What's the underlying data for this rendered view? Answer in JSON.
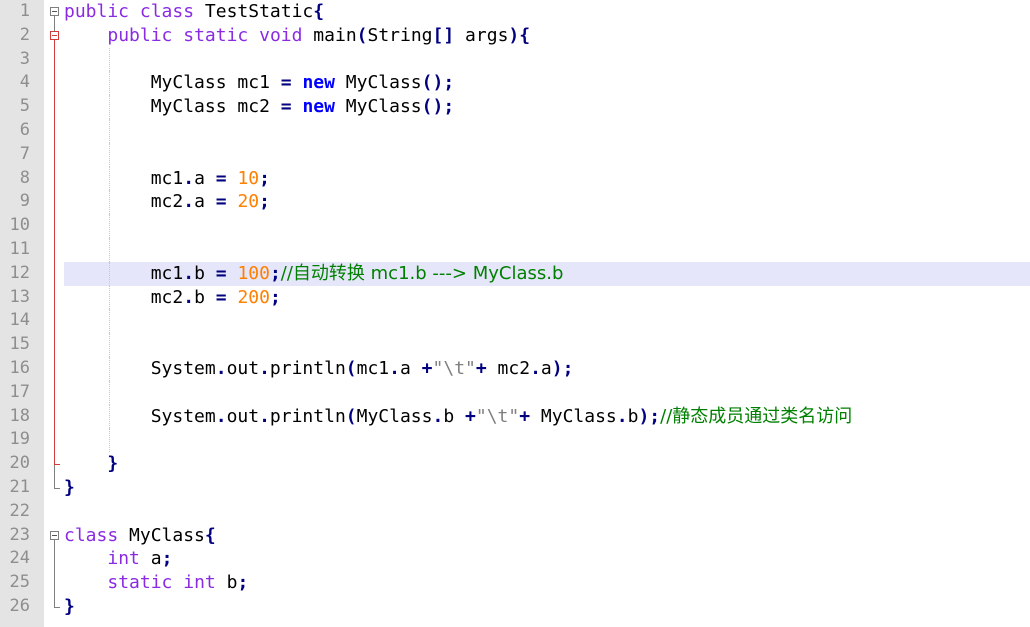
{
  "editor": {
    "language": "Java",
    "current_line": 12,
    "colors": {
      "keyword": "#8a2be2",
      "new_keyword": "#0000ff",
      "operator": "#000080",
      "number": "#ff8000",
      "string": "#808080",
      "comment": "#008000",
      "gutter_bg": "#e4e4e4",
      "current_line_bg": "#e6e6fa",
      "fold_marker": "#d23b3b"
    },
    "lines": [
      {
        "n": "1",
        "tokens": [
          {
            "t": "public",
            "c": "kw"
          },
          {
            "t": " ",
            "c": "pl"
          },
          {
            "t": "class",
            "c": "kw"
          },
          {
            "t": " TestStatic",
            "c": "pl"
          },
          {
            "t": "{",
            "c": "op"
          }
        ]
      },
      {
        "n": "2",
        "tokens": [
          {
            "t": "    ",
            "c": "pl"
          },
          {
            "t": "public",
            "c": "kw"
          },
          {
            "t": " ",
            "c": "pl"
          },
          {
            "t": "static",
            "c": "kw"
          },
          {
            "t": " ",
            "c": "pl"
          },
          {
            "t": "void",
            "c": "kw"
          },
          {
            "t": " main",
            "c": "pl"
          },
          {
            "t": "(",
            "c": "op"
          },
          {
            "t": "String",
            "c": "pl"
          },
          {
            "t": "[]",
            "c": "op"
          },
          {
            "t": " args",
            "c": "pl"
          },
          {
            "t": "){",
            "c": "op"
          }
        ]
      },
      {
        "n": "3",
        "tokens": []
      },
      {
        "n": "4",
        "tokens": [
          {
            "t": "        MyClass mc1 ",
            "c": "pl"
          },
          {
            "t": "=",
            "c": "op"
          },
          {
            "t": " ",
            "c": "pl"
          },
          {
            "t": "new",
            "c": "kwb"
          },
          {
            "t": " MyClass",
            "c": "pl"
          },
          {
            "t": "();",
            "c": "op"
          }
        ]
      },
      {
        "n": "5",
        "tokens": [
          {
            "t": "        MyClass mc2 ",
            "c": "pl"
          },
          {
            "t": "=",
            "c": "op"
          },
          {
            "t": " ",
            "c": "pl"
          },
          {
            "t": "new",
            "c": "kwb"
          },
          {
            "t": " MyClass",
            "c": "pl"
          },
          {
            "t": "();",
            "c": "op"
          }
        ]
      },
      {
        "n": "6",
        "tokens": []
      },
      {
        "n": "7",
        "tokens": []
      },
      {
        "n": "8",
        "tokens": [
          {
            "t": "        mc1",
            "c": "pl"
          },
          {
            "t": ".",
            "c": "op"
          },
          {
            "t": "a ",
            "c": "pl"
          },
          {
            "t": "=",
            "c": "op"
          },
          {
            "t": " ",
            "c": "pl"
          },
          {
            "t": "10",
            "c": "num"
          },
          {
            "t": ";",
            "c": "op"
          }
        ]
      },
      {
        "n": "9",
        "tokens": [
          {
            "t": "        mc2",
            "c": "pl"
          },
          {
            "t": ".",
            "c": "op"
          },
          {
            "t": "a ",
            "c": "pl"
          },
          {
            "t": "=",
            "c": "op"
          },
          {
            "t": " ",
            "c": "pl"
          },
          {
            "t": "20",
            "c": "num"
          },
          {
            "t": ";",
            "c": "op"
          }
        ]
      },
      {
        "n": "10",
        "tokens": []
      },
      {
        "n": "11",
        "tokens": []
      },
      {
        "n": "12",
        "tokens": [
          {
            "t": "        mc1",
            "c": "pl"
          },
          {
            "t": ".",
            "c": "op"
          },
          {
            "t": "b ",
            "c": "pl"
          },
          {
            "t": "=",
            "c": "op"
          },
          {
            "t": " ",
            "c": "pl"
          },
          {
            "t": "100",
            "c": "num"
          },
          {
            "t": ";",
            "c": "op"
          },
          {
            "t": "//自动转换 mc1.b ---> MyClass.b",
            "c": "cm"
          }
        ]
      },
      {
        "n": "13",
        "tokens": [
          {
            "t": "        mc2",
            "c": "pl"
          },
          {
            "t": ".",
            "c": "op"
          },
          {
            "t": "b ",
            "c": "pl"
          },
          {
            "t": "=",
            "c": "op"
          },
          {
            "t": " ",
            "c": "pl"
          },
          {
            "t": "200",
            "c": "num"
          },
          {
            "t": ";",
            "c": "op"
          }
        ]
      },
      {
        "n": "14",
        "tokens": []
      },
      {
        "n": "15",
        "tokens": []
      },
      {
        "n": "16",
        "tokens": [
          {
            "t": "        System",
            "c": "pl"
          },
          {
            "t": ".",
            "c": "op"
          },
          {
            "t": "out",
            "c": "pl"
          },
          {
            "t": ".",
            "c": "op"
          },
          {
            "t": "println",
            "c": "pl"
          },
          {
            "t": "(",
            "c": "op"
          },
          {
            "t": "mc1",
            "c": "pl"
          },
          {
            "t": ".",
            "c": "op"
          },
          {
            "t": "a ",
            "c": "pl"
          },
          {
            "t": "+",
            "c": "op"
          },
          {
            "t": "\"\\t\"",
            "c": "str"
          },
          {
            "t": "+",
            "c": "op"
          },
          {
            "t": " mc2",
            "c": "pl"
          },
          {
            "t": ".",
            "c": "op"
          },
          {
            "t": "a",
            "c": "pl"
          },
          {
            "t": ");",
            "c": "op"
          }
        ]
      },
      {
        "n": "17",
        "tokens": []
      },
      {
        "n": "18",
        "tokens": [
          {
            "t": "        System",
            "c": "pl"
          },
          {
            "t": ".",
            "c": "op"
          },
          {
            "t": "out",
            "c": "pl"
          },
          {
            "t": ".",
            "c": "op"
          },
          {
            "t": "println",
            "c": "pl"
          },
          {
            "t": "(",
            "c": "op"
          },
          {
            "t": "MyClass",
            "c": "pl"
          },
          {
            "t": ".",
            "c": "op"
          },
          {
            "t": "b ",
            "c": "pl"
          },
          {
            "t": "+",
            "c": "op"
          },
          {
            "t": "\"\\t\"",
            "c": "str"
          },
          {
            "t": "+",
            "c": "op"
          },
          {
            "t": " MyClass",
            "c": "pl"
          },
          {
            "t": ".",
            "c": "op"
          },
          {
            "t": "b",
            "c": "pl"
          },
          {
            "t": ");",
            "c": "op"
          },
          {
            "t": "//静态成员通过类名访问",
            "c": "cm"
          }
        ]
      },
      {
        "n": "19",
        "tokens": []
      },
      {
        "n": "20",
        "tokens": [
          {
            "t": "    ",
            "c": "pl"
          },
          {
            "t": "}",
            "c": "op"
          }
        ]
      },
      {
        "n": "21",
        "tokens": [
          {
            "t": "}",
            "c": "op"
          }
        ]
      },
      {
        "n": "22",
        "tokens": []
      },
      {
        "n": "23",
        "tokens": [
          {
            "t": "class",
            "c": "kw"
          },
          {
            "t": " MyClass",
            "c": "pl"
          },
          {
            "t": "{",
            "c": "op"
          }
        ]
      },
      {
        "n": "24",
        "tokens": [
          {
            "t": "    ",
            "c": "pl"
          },
          {
            "t": "int",
            "c": "kw"
          },
          {
            "t": " a",
            "c": "pl"
          },
          {
            "t": ";",
            "c": "op"
          }
        ]
      },
      {
        "n": "25",
        "tokens": [
          {
            "t": "    ",
            "c": "pl"
          },
          {
            "t": "static",
            "c": "kw"
          },
          {
            "t": " ",
            "c": "pl"
          },
          {
            "t": "int",
            "c": "kw"
          },
          {
            "t": " b",
            "c": "pl"
          },
          {
            "t": ";",
            "c": "op"
          }
        ]
      },
      {
        "n": "26",
        "tokens": [
          {
            "t": "}",
            "c": "op"
          }
        ]
      }
    ]
  }
}
